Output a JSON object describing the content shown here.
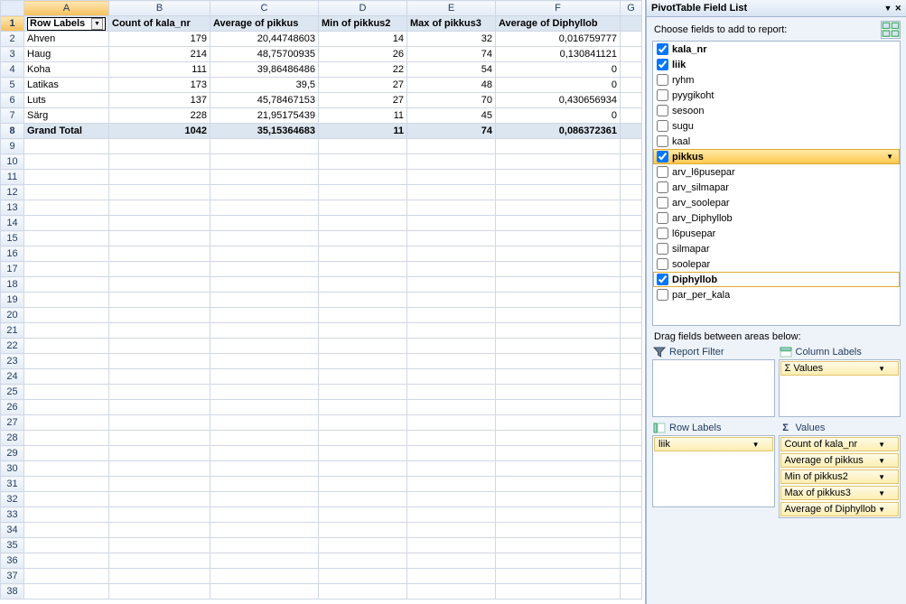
{
  "grid": {
    "columns": [
      "A",
      "B",
      "C",
      "D",
      "E",
      "F",
      "G"
    ],
    "header": {
      "rowLabels": "Row Labels",
      "b": "Count of kala_nr",
      "c": "Average of pikkus",
      "d": "Min of pikkus2",
      "e": "Max of pikkus3",
      "f": "Average of Diphyllob"
    },
    "rows": [
      {
        "a": "Ahven",
        "b": "179",
        "c": "20,44748603",
        "d": "14",
        "e": "32",
        "f": "0,016759777"
      },
      {
        "a": "Haug",
        "b": "214",
        "c": "48,75700935",
        "d": "26",
        "e": "74",
        "f": "0,130841121"
      },
      {
        "a": "Koha",
        "b": "111",
        "c": "39,86486486",
        "d": "22",
        "e": "54",
        "f": "0"
      },
      {
        "a": "Latikas",
        "b": "173",
        "c": "39,5",
        "d": "27",
        "e": "48",
        "f": "0"
      },
      {
        "a": "Luts",
        "b": "137",
        "c": "45,78467153",
        "d": "27",
        "e": "70",
        "f": "0,430656934"
      },
      {
        "a": "Särg",
        "b": "228",
        "c": "21,95175439",
        "d": "11",
        "e": "45",
        "f": "0"
      }
    ],
    "total": {
      "a": "Grand Total",
      "b": "1042",
      "c": "35,15364683",
      "d": "11",
      "e": "74",
      "f": "0,086372361"
    },
    "blankRows": 30
  },
  "panel": {
    "title": "PivotTable Field List",
    "chooseLabel": "Choose fields to add to report:",
    "fields": [
      {
        "name": "kala_nr",
        "checked": true
      },
      {
        "name": "liik",
        "checked": true
      },
      {
        "name": "ryhm",
        "checked": false
      },
      {
        "name": "pyygikoht",
        "checked": false
      },
      {
        "name": "sesoon",
        "checked": false
      },
      {
        "name": "sugu",
        "checked": false
      },
      {
        "name": "kaal",
        "checked": false
      },
      {
        "name": "pikkus",
        "checked": true,
        "highlight": true
      },
      {
        "name": "arv_l6pusepar",
        "checked": false
      },
      {
        "name": "arv_silmapar",
        "checked": false
      },
      {
        "name": "arv_soolepar",
        "checked": false
      },
      {
        "name": "arv_Diphyllob",
        "checked": false
      },
      {
        "name": "l6pusepar",
        "checked": false
      },
      {
        "name": "silmapar",
        "checked": false
      },
      {
        "name": "soolepar",
        "checked": false
      },
      {
        "name": "Diphyllob",
        "checked": true,
        "outlined": true
      },
      {
        "name": "par_per_kala",
        "checked": false
      }
    ],
    "dragLabel": "Drag fields between areas below:",
    "areas": {
      "reportFilter": {
        "label": "Report Filter",
        "items": []
      },
      "columnLabels": {
        "label": "Column Labels",
        "items": [
          "Values"
        ]
      },
      "rowLabels": {
        "label": "Row Labels",
        "items": [
          "liik"
        ]
      },
      "values": {
        "label": "Values",
        "items": [
          "Count of kala_nr",
          "Average of pikkus",
          "Min of pikkus2",
          "Max of pikkus3",
          "Average of Diphyllob"
        ]
      }
    },
    "sigma": "Σ"
  }
}
